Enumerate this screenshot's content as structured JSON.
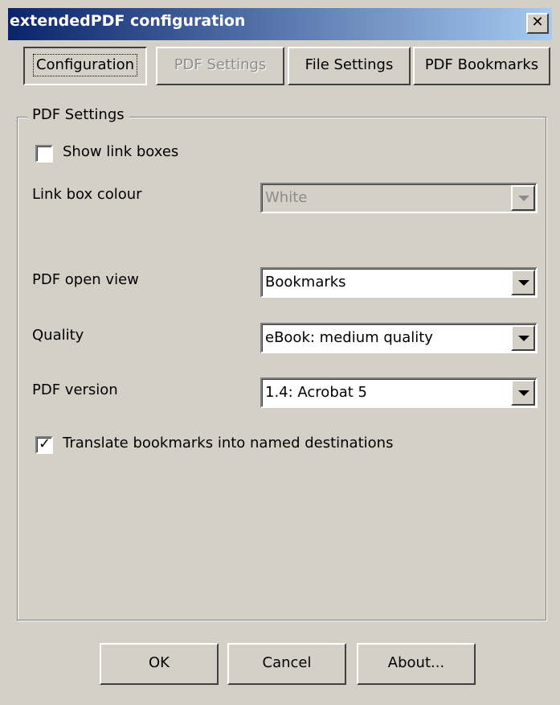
{
  "window": {
    "title": "extendedPDF configuration"
  },
  "icons": {
    "close": "close-icon",
    "dropdown": "chevron-down-icon",
    "check": "checkmark-icon"
  },
  "tabs": [
    {
      "label": "Configuration",
      "state": "pressed"
    },
    {
      "label": "PDF Settings",
      "state": "disabled"
    },
    {
      "label": "File Settings",
      "state": "normal"
    },
    {
      "label": "PDF Bookmarks",
      "state": "normal"
    }
  ],
  "group": {
    "title": "PDF Settings"
  },
  "show_link_boxes": {
    "label": "Show link boxes",
    "checked": false
  },
  "link_box_colour": {
    "label": "Link box colour",
    "value": "White",
    "enabled": false
  },
  "pdf_open_view": {
    "label": "PDF open view",
    "value": "Bookmarks"
  },
  "quality": {
    "label": "Quality",
    "value": "eBook: medium quality"
  },
  "pdf_version": {
    "label": "PDF version",
    "value": "1.4: Acrobat 5"
  },
  "translate_bookmarks": {
    "label": "Translate bookmarks into named destinations",
    "checked": true
  },
  "buttons": {
    "ok": "OK",
    "cancel": "Cancel",
    "about": "About..."
  }
}
